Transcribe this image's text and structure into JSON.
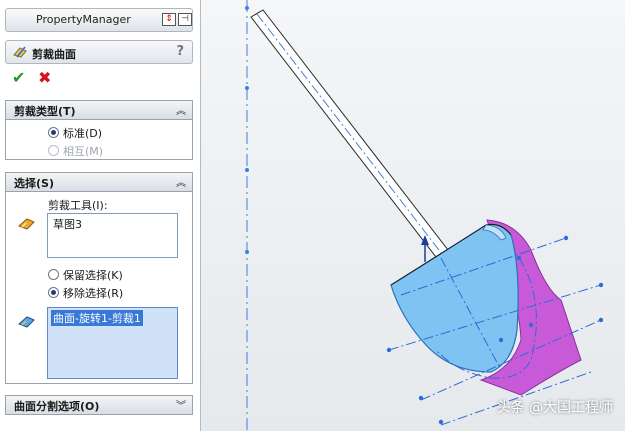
{
  "property_manager": {
    "title": "PropertyManager",
    "feature_name": "剪裁曲面",
    "help_icon": "?",
    "ok_glyph": "✔",
    "cancel_glyph": "✖"
  },
  "trim_type": {
    "header": "剪裁类型(T)",
    "options": [
      {
        "label": "标准(D)",
        "selected": true,
        "enabled": true
      },
      {
        "label": "相互(M)",
        "selected": false,
        "enabled": false
      }
    ]
  },
  "selections": {
    "header": "选择(S)",
    "trim_tool_label": "剪裁工具(I):",
    "trim_tool_value": "草图3",
    "keep_option": "保留选择(K)",
    "remove_option": "移除选择(R)",
    "remove_selected": true,
    "pieces_value": "曲面-旋转1-剪裁1"
  },
  "split_options": {
    "header": "曲面分割选项(O)"
  },
  "watermark": "头条 @大国工程师",
  "colors": {
    "surface_blue": "#7fc3f3",
    "surface_magenta": "#c85ad7",
    "sketch_line": "#2f6bd6",
    "selection_highlight": "#3a78d6"
  }
}
